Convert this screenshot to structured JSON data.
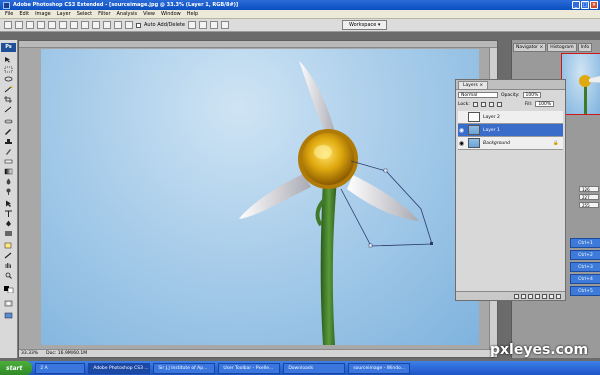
{
  "window": {
    "title": "Adobe Photoshop CS3 Extended - [sourceimage.jpg @ 33.3% (Layer 1, RGB/8#)]"
  },
  "menus": [
    "File",
    "Edit",
    "Image",
    "Layer",
    "Select",
    "Filter",
    "Analysis",
    "View",
    "Window",
    "Help"
  ],
  "options": {
    "auto_add_delete": "Auto Add/Delete",
    "workspace": "Workspace ▾"
  },
  "toolbox": {
    "badge": "Ps"
  },
  "document": {
    "zoom": "33.33%",
    "doc_size": "Doc: 16.9M/60.1M"
  },
  "layers_panel": {
    "tab": "Layers ×",
    "blend_mode": "Normal",
    "opacity_label": "Opacity:",
    "opacity_value": "100%",
    "lock_label": "Lock:",
    "fill_label": "Fill:",
    "fill_value": "100%",
    "layers": [
      {
        "name": "Layer 2",
        "visible": false,
        "selected": false,
        "italic": false
      },
      {
        "name": "Layer 1",
        "visible": true,
        "selected": true,
        "italic": false
      },
      {
        "name": "Background",
        "visible": true,
        "selected": false,
        "italic": true
      }
    ]
  },
  "right_dock": {
    "tabs": [
      "Navigator ×",
      "Histogram",
      "Info"
    ],
    "fields": [
      "126",
      "227",
      "255"
    ],
    "shortcuts": [
      "Ctrl+1",
      "Ctrl+2",
      "Ctrl+3",
      "Ctrl+4",
      "Ctrl+5"
    ]
  },
  "taskbar": {
    "start": "start",
    "tasks": [
      {
        "label": "2 A",
        "active": false
      },
      {
        "label": "Adobe Photoshop CS3 ...",
        "active": true
      },
      {
        "label": "Sir J.J Institute of Ap...",
        "active": false
      },
      {
        "label": "User Toolbar - Pxelle...",
        "active": false
      },
      {
        "label": "Downloads",
        "active": false
      },
      {
        "label": "sourceimage - Windo...",
        "active": false
      }
    ]
  },
  "watermark": "pxleyes.com",
  "colors": {
    "selection_blue": "#3a6dc9",
    "sky_light": "#cfe4f4",
    "sky_dark": "#7fb3de",
    "flower_center": "#e0a90f",
    "stem": "#3f7a2a"
  }
}
